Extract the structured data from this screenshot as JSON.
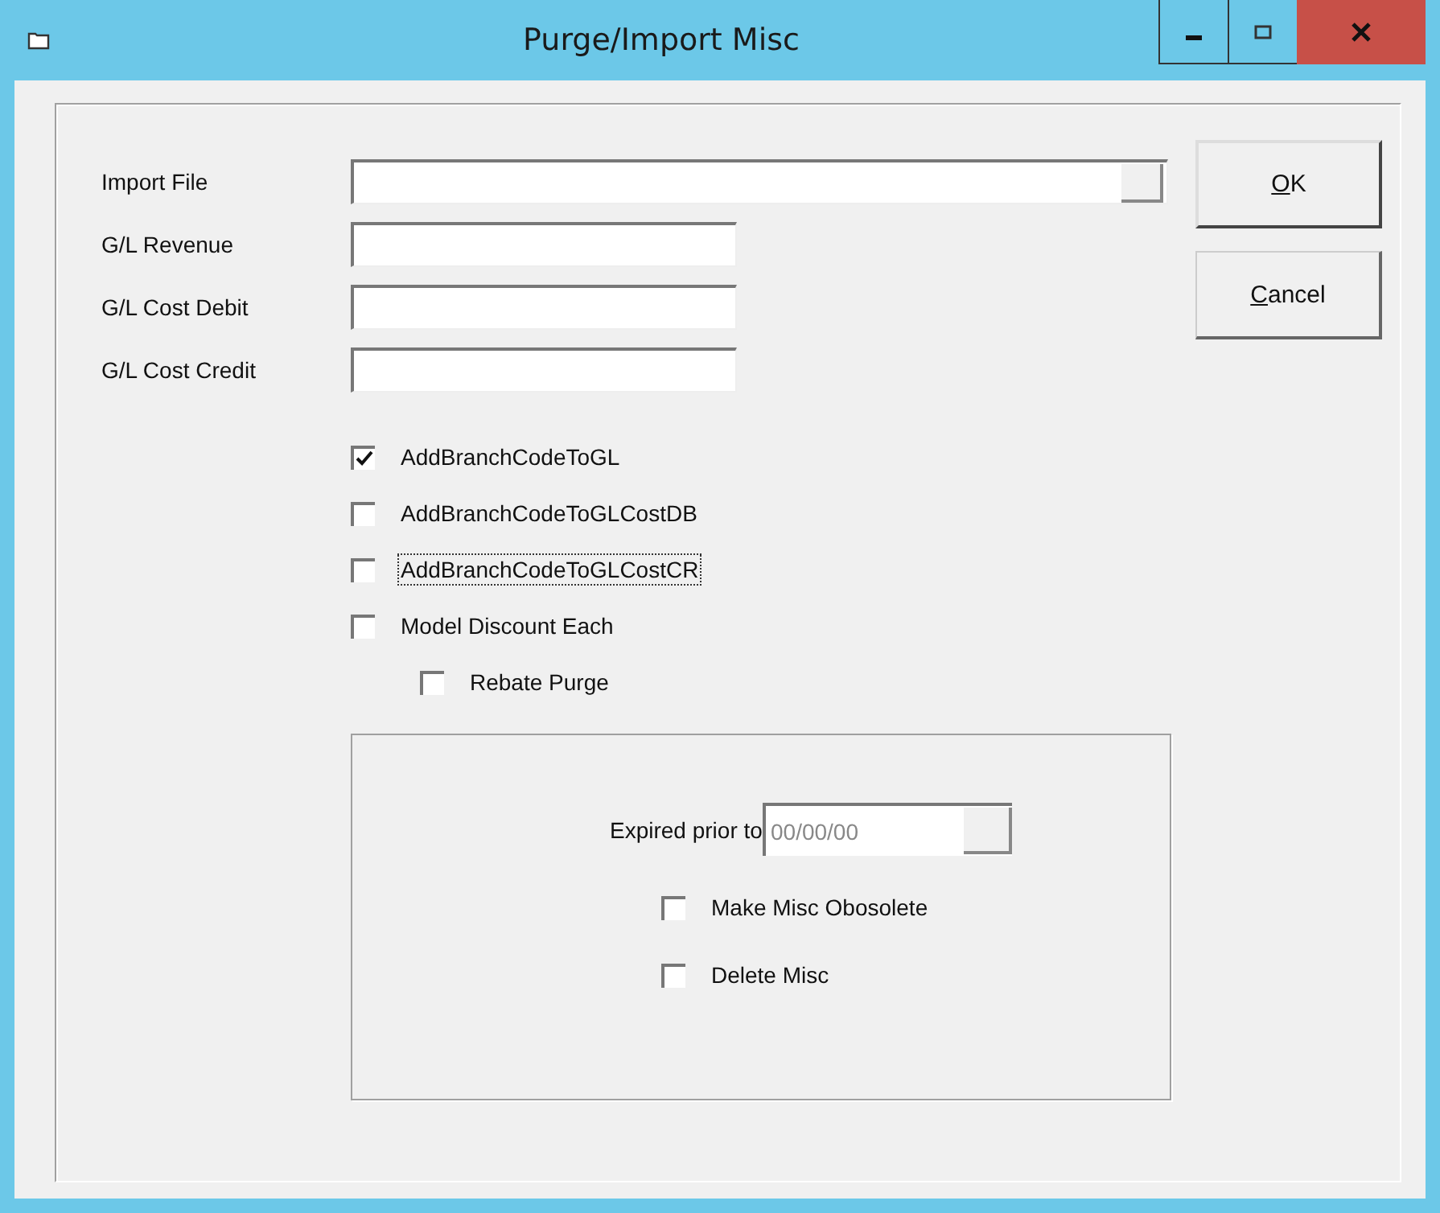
{
  "window": {
    "title": "Purge/Import Misc"
  },
  "fields": [
    {
      "label": "Import File",
      "kind": "browse"
    },
    {
      "label": "G/L Revenue",
      "kind": "text"
    },
    {
      "label": "G/L Cost Debit",
      "kind": "text"
    },
    {
      "label": "G/L Cost Credit",
      "kind": "text"
    }
  ],
  "checkboxes": [
    {
      "label": "AddBranchCodeToGL",
      "checked": true,
      "focused": false,
      "indented": false
    },
    {
      "label": "AddBranchCodeToGLCostDB",
      "checked": false,
      "focused": false,
      "indented": false
    },
    {
      "label": "AddBranchCodeToGLCostCR",
      "checked": false,
      "focused": true,
      "indented": false
    },
    {
      "label": "Model Discount Each",
      "checked": false,
      "focused": false,
      "indented": false
    },
    {
      "label": "Rebate Purge",
      "checked": false,
      "focused": false,
      "indented": true
    }
  ],
  "purge_group": {
    "date_label": "Expired prior to",
    "date_value": "00/00/00",
    "date_disabled": true,
    "checkboxes": [
      {
        "label": "Make Misc Obosolete",
        "checked": false
      },
      {
        "label": "Delete Misc",
        "checked": false
      }
    ]
  },
  "buttons": [
    {
      "label": "OK",
      "default": true
    },
    {
      "label": "Cancel",
      "default": false
    }
  ]
}
